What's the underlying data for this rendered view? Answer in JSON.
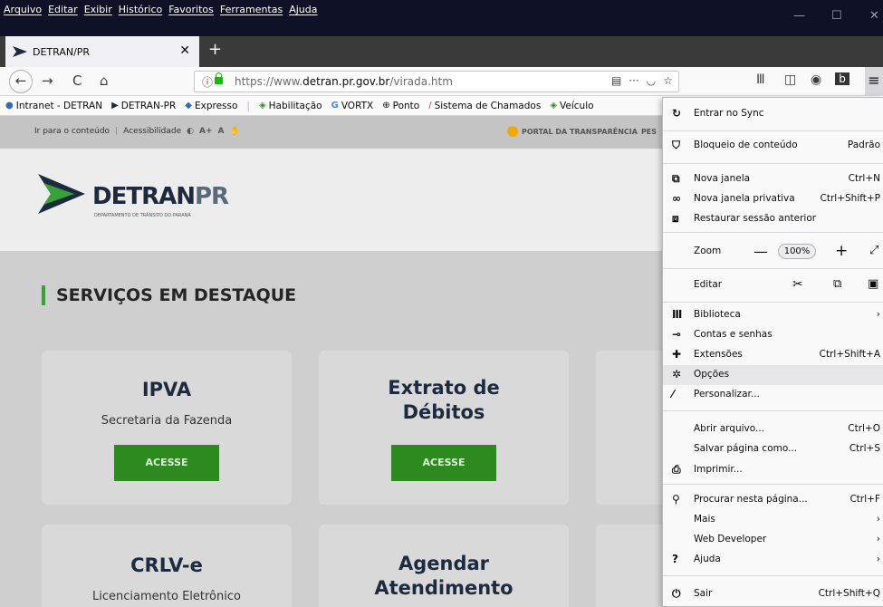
{
  "menubar": {
    "items": [
      "Arquivo",
      "Editar",
      "Exibir",
      "Histórico",
      "Favoritos",
      "Ferramentas",
      "Ajuda"
    ]
  },
  "tab": {
    "title": "DETRAN/PR"
  },
  "urlbar": {
    "url_prefix": "https://www.",
    "url_domain": "detran.pr.gov.br",
    "url_path": "/virada.htm"
  },
  "bookmarks": [
    {
      "label": "Intranet - DETRAN",
      "icon": "globe-icon"
    },
    {
      "label": "DETRAN-PR",
      "icon": "detran-icon"
    },
    {
      "label": "Expresso",
      "icon": "expresso-icon"
    },
    {
      "label": "Habilitação",
      "icon": "crest-icon"
    },
    {
      "label": "VORTX",
      "icon": "google-icon"
    },
    {
      "label": "Ponto",
      "icon": "globe-icon"
    },
    {
      "label": "Sistema de Chamados",
      "icon": "pen-icon"
    },
    {
      "label": "Veículo",
      "icon": "crest-icon"
    }
  ],
  "page": {
    "access_bar": {
      "skip_link": "Ir para o conteúdo",
      "accessibility": "Acessibilidade",
      "font_larger": "A+",
      "font_normal": "A",
      "transparency": "PORTAL DA TRANSPARÊNCIA",
      "transparency_more": "PES"
    },
    "logo": {
      "main": "DETRAN",
      "pr": "PR",
      "sub": "DEPARTAMENTO DE TRÂNSITO DO PARANÁ"
    },
    "section_title": "SERVIÇOS EM DESTAQUE",
    "cards": [
      {
        "title": "IPVA",
        "subtitle": "Secretaria da Fazenda",
        "button": "ACESSE"
      },
      {
        "title": "Extrato de Débitos",
        "subtitle": "",
        "button": "ACESSE"
      },
      {
        "title": "CRLV-e",
        "subtitle": "Licenciamento Eletrônico"
      },
      {
        "title": "Agendar Atendimento",
        "subtitle": ""
      }
    ]
  },
  "ffmenu": {
    "sync": "Entrar no Sync",
    "content_blocking": "Bloqueio de conteúdo",
    "content_blocking_value": "Padrão",
    "new_window": "Nova janela",
    "new_window_sc": "Ctrl+N",
    "private_window": "Nova janela privativa",
    "private_window_sc": "Ctrl+Shift+P",
    "restore": "Restaurar sessão anterior",
    "zoom": "Zoom",
    "zoom_value": "100%",
    "edit": "Editar",
    "library": "Biblioteca",
    "logins": "Contas e senhas",
    "addons": "Extensões",
    "addons_sc": "Ctrl+Shift+A",
    "options": "Opções",
    "customize": "Personalizar...",
    "open_file": "Abrir arquivo...",
    "open_file_sc": "Ctrl+O",
    "save_page": "Salvar página como...",
    "save_page_sc": "Ctrl+S",
    "print": "Imprimir...",
    "find": "Procurar nesta página...",
    "find_sc": "Ctrl+F",
    "more": "Mais",
    "web_dev": "Web Developer",
    "help": "Ajuda",
    "quit": "Sair",
    "quit_sc": "Ctrl+Shift+Q"
  }
}
